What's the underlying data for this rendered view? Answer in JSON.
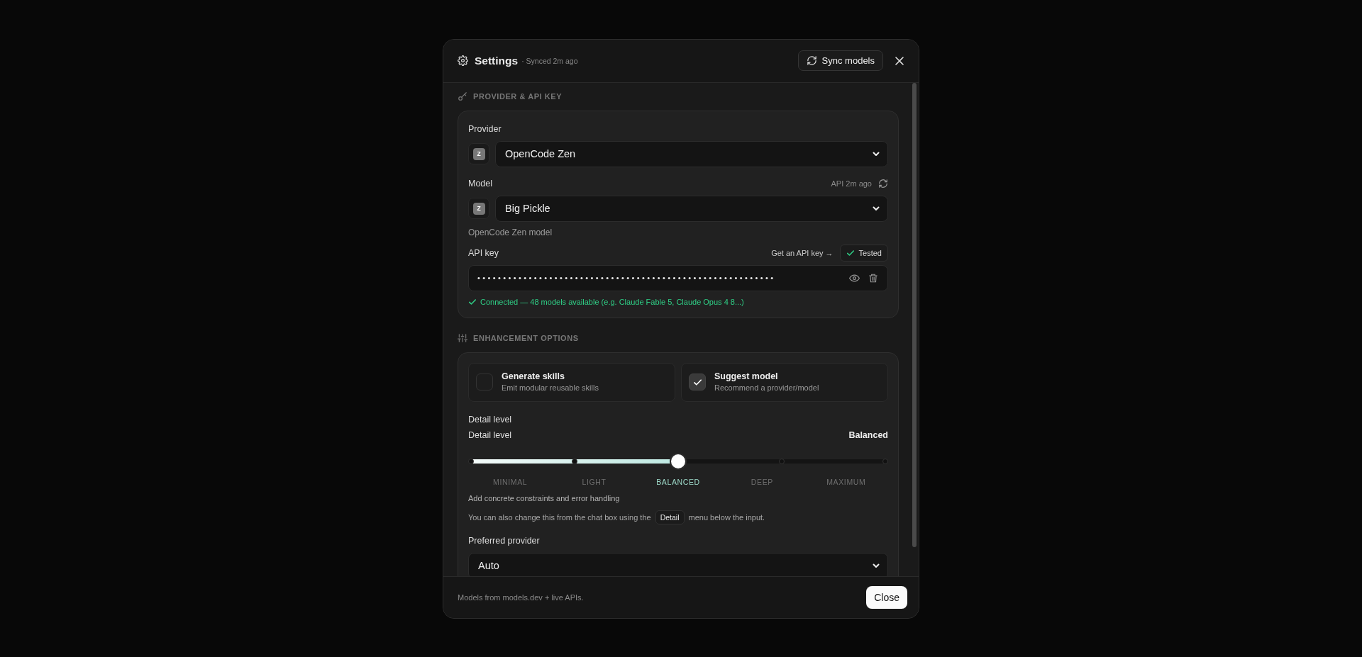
{
  "dialog": {
    "title": "Settings",
    "sync_status": "· Synced 2m ago",
    "sync_button": "Sync models"
  },
  "provider_section": {
    "heading": "PROVIDER & API KEY",
    "provider": {
      "label": "Provider",
      "badge": "Z",
      "value": "OpenCode Zen"
    },
    "model": {
      "label": "Model",
      "api_status": "API 2m ago",
      "badge": "Z",
      "value": "Big Pickle",
      "hint": "OpenCode Zen model"
    },
    "api_key": {
      "label": "API key",
      "link": "Get an API key →",
      "tested": "Tested",
      "masked_value": "••••••••••••••••••••••••••••••••••••••••••••••••••••••••••",
      "status": "Connected — 48 models available (e.g. Claude Fable 5, Claude Opus 4 8...)"
    }
  },
  "enhancement_section": {
    "heading": "ENHANCEMENT OPTIONS",
    "options": [
      {
        "title": "Generate skills",
        "description": "Emit modular reusable skills",
        "checked": false
      },
      {
        "title": "Suggest model",
        "description": "Recommend a provider/model",
        "checked": true
      }
    ],
    "detail": {
      "label": "Detail level",
      "sublabel": "Detail level",
      "value_label": "Balanced",
      "level": 0.5,
      "stops": [
        {
          "label": "MINIMAL",
          "selected": false
        },
        {
          "label": "LIGHT",
          "selected": false
        },
        {
          "label": "BALANCED",
          "selected": true
        },
        {
          "label": "DEEP",
          "selected": false
        },
        {
          "label": "MAXIMUM",
          "selected": false
        }
      ],
      "description": "Add concrete constraints and error handling",
      "note_before": "You can also change this from the chat box using the",
      "note_chip": "Detail",
      "note_after": "menu below the input."
    },
    "preferred_provider": {
      "label": "Preferred provider",
      "value": "Auto"
    }
  },
  "footer": {
    "note": "Models from models.dev + live APIs.",
    "close_button": "Close"
  }
}
